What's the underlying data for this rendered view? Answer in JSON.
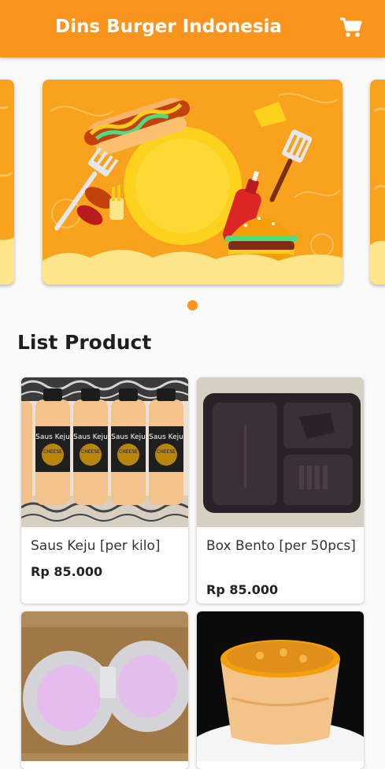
{
  "app": {
    "title": "Dins Burger Indonesia",
    "cart_icon": "shopping-cart-icon"
  },
  "colors": {
    "primary": "#f9951d",
    "background": "#fafafa"
  },
  "carousel": {
    "active_index": 0,
    "dot_count": 1
  },
  "section": {
    "title": "List Product"
  },
  "products": [
    {
      "name": "Saus Keju [per kilo]",
      "price": "Rp 85.000",
      "label": "Saus Keju",
      "sub": "CHEESE"
    },
    {
      "name": "Box Bento [per 50pcs]",
      "price": "Rp 85.000"
    },
    {
      "name": "",
      "price": ""
    },
    {
      "name": "",
      "price": ""
    }
  ]
}
